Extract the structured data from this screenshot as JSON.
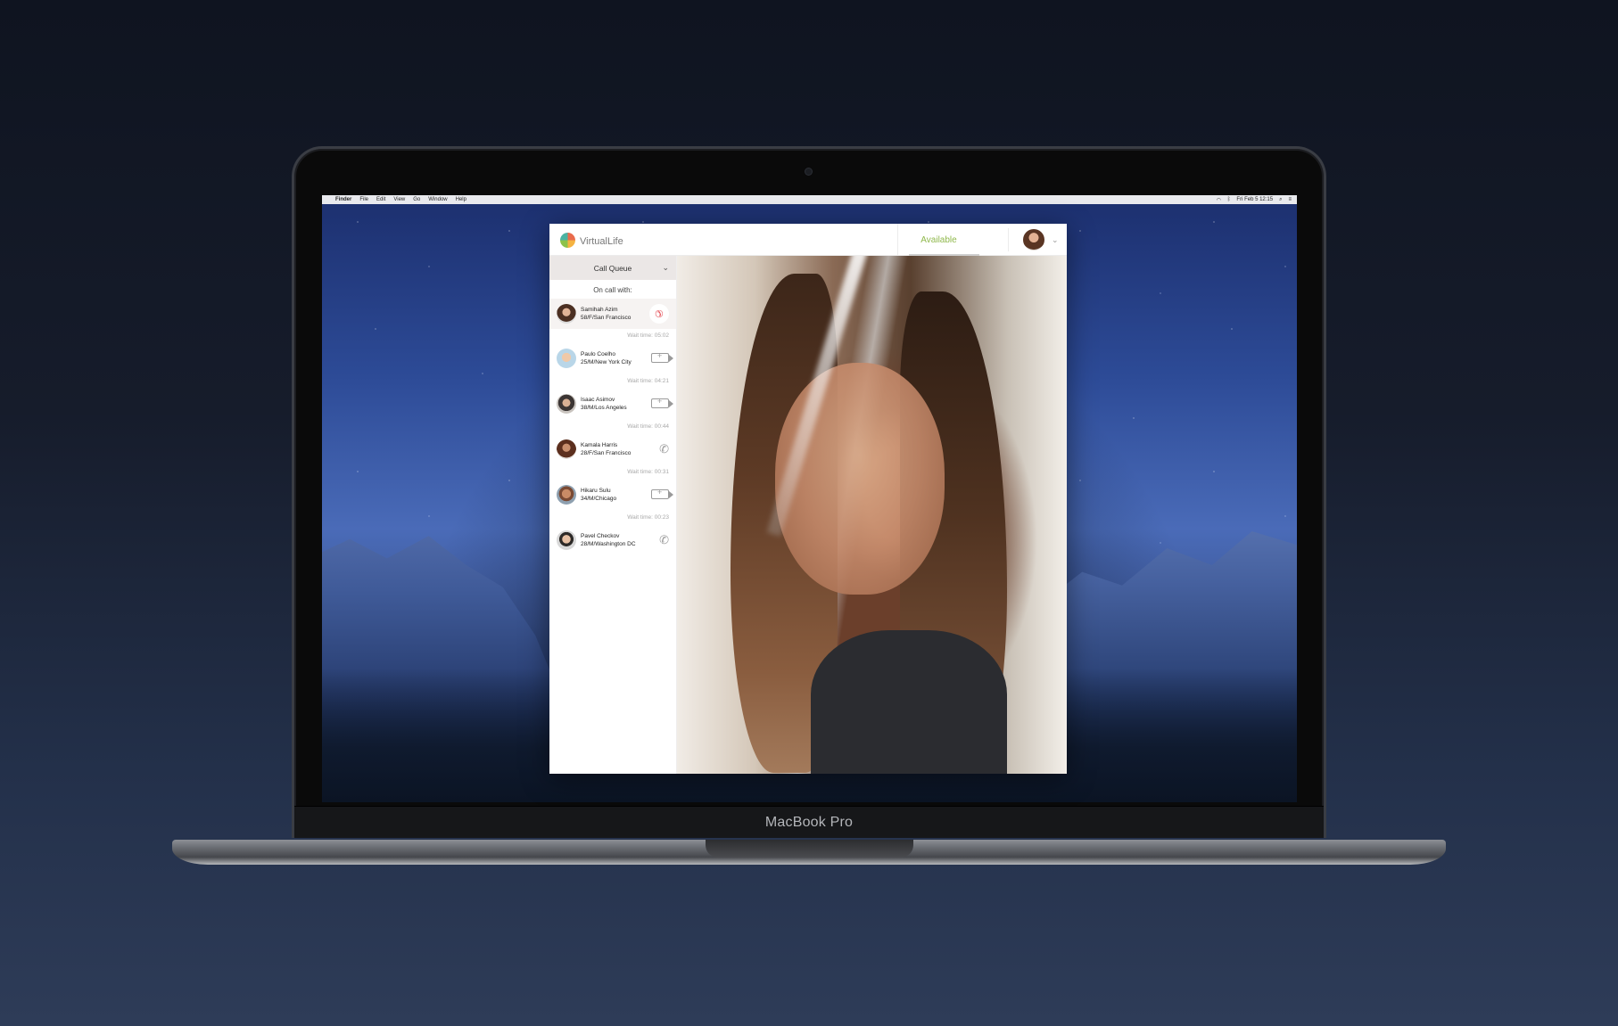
{
  "menubar": {
    "apple": "",
    "items": [
      "Finder",
      "File",
      "Edit",
      "View",
      "Go",
      "Window",
      "Help"
    ],
    "clock": "Fri Feb 5 12:15"
  },
  "app": {
    "name": "VirtualLife",
    "status": "Available"
  },
  "sidebar": {
    "header": "Call Queue",
    "oncall_label": "On call with:",
    "oncall": {
      "name": "Samihah Azim",
      "details": "58/F/San Francisco"
    },
    "queue": [
      {
        "wait": "Wait time: 05:02",
        "name": "Paulo Coelho",
        "details": "25/M/New York City",
        "type": "video"
      },
      {
        "wait": "Wait time: 04:21",
        "name": "Isaac Asimov",
        "details": "38/M/Los Angeles",
        "type": "video"
      },
      {
        "wait": "Wait time: 00:44",
        "name": "Kamala Harris",
        "details": "28/F/San Francisco",
        "type": "phone"
      },
      {
        "wait": "Wait time: 00:31",
        "name": "Hikaru Sulu",
        "details": "34/M/Chicago",
        "type": "video"
      },
      {
        "wait": "Wait time: 00:23",
        "name": "Pavel Checkov",
        "details": "28/M/Washington DC",
        "type": "phone"
      }
    ]
  },
  "device": {
    "label": "MacBook Pro"
  },
  "colors": {
    "accent": "#8fb84b",
    "hangup": "#e44a52"
  }
}
